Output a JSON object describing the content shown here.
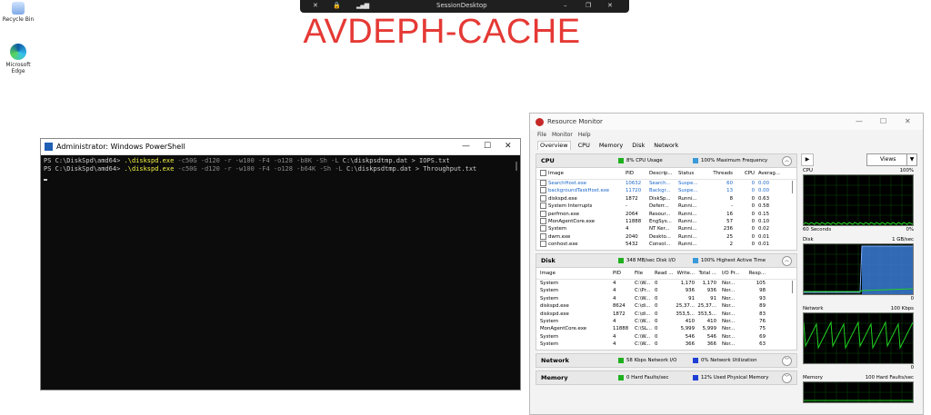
{
  "desktop": {
    "icons": [
      {
        "label": "Recycle Bin",
        "icon": "recycle-bin-icon"
      },
      {
        "label": "Microsoft Edge",
        "icon": "edge-icon"
      }
    ]
  },
  "session_bar": {
    "title": "SessionDesktop",
    "min": "–",
    "restore": "❐",
    "close": "✕"
  },
  "banner": {
    "text": "AVDEPH-CACHE",
    "color": "#e53935"
  },
  "powershell": {
    "title": "Administrator: Windows PowerShell",
    "lines": [
      {
        "prompt": "PS C:\\DiskSpd\\amd64> ",
        "cmd": ".\\diskspd.exe",
        "args": " -c50G -d120 -r -w100 -F4 -o128 -b8K -Sh -L ",
        "tail": "C:\\diskpsdtmp.dat > IOPS.txt"
      },
      {
        "prompt": "PS C:\\DiskSpd\\amd64> ",
        "cmd": ".\\diskspd.exe",
        "args": " -c50G -d120 -r -w100 -F4 -o128 -b64K -Sh -L ",
        "tail": "C:\\diskpsdtmp.dat > Throughput.txt"
      }
    ]
  },
  "resmon": {
    "title": "Resource Monitor",
    "menu": [
      "File",
      "Monitor",
      "Help"
    ],
    "tabs": [
      "Overview",
      "CPU",
      "Memory",
      "Disk",
      "Network"
    ],
    "cpu": {
      "name": "CPU",
      "usage": "8% CPU Usage",
      "freq": "100% Maximum Frequency",
      "headers": [
        "Image",
        "PID",
        "Descrip...",
        "Status",
        "Threads",
        "CPU",
        "Averag..."
      ],
      "rows": [
        [
          "SearchHost.exe",
          "10632",
          "Search...",
          "Suspe...",
          "60",
          "0",
          "0.00"
        ],
        [
          "backgroundTaskHost.exe",
          "11720",
          "Backgr...",
          "Suspe...",
          "13",
          "0",
          "0.00"
        ],
        [
          "diskspd.exe",
          "1872",
          "DiskSp...",
          "Runni...",
          "8",
          "0",
          "0.63"
        ],
        [
          "System Interrupts",
          "-",
          "Deferr...",
          "Runni...",
          "-",
          "0",
          "0.58"
        ],
        [
          "perfmon.exe",
          "2064",
          "Resour...",
          "Runni...",
          "16",
          "0",
          "0.15"
        ],
        [
          "MonAgentCore.exe",
          "11888",
          "EngSys...",
          "Runni...",
          "57",
          "0",
          "0.10"
        ],
        [
          "System",
          "4",
          "NT Ker...",
          "Runni...",
          "236",
          "0",
          "0.02"
        ],
        [
          "dwm.exe",
          "2040",
          "Deskto...",
          "Runni...",
          "25",
          "0",
          "0.01"
        ],
        [
          "conhost.exe",
          "5432",
          "Consol...",
          "Runni...",
          "2",
          "0",
          "0.01"
        ]
      ]
    },
    "disk": {
      "name": "Disk",
      "io": "348 MB/sec Disk I/O",
      "active": "100% Highest Active Time",
      "headers": [
        "Image",
        "PID",
        "File",
        "Read ...",
        "Write...",
        "Total ...",
        "I/O Pr...",
        "Resp..."
      ],
      "rows": [
        [
          "System",
          "4",
          "C:\\W...",
          "0",
          "1,170",
          "1,170",
          "Nor...",
          "105"
        ],
        [
          "System",
          "4",
          "C:\\Pr...",
          "0",
          "936",
          "936",
          "Nor...",
          "98"
        ],
        [
          "System",
          "4",
          "C:\\W...",
          "0",
          "91",
          "91",
          "Nor...",
          "93"
        ],
        [
          "diskspd.exe",
          "8624",
          "C:\\di...",
          "0",
          "25,37...",
          "25,37...",
          "Nor...",
          "89"
        ],
        [
          "diskspd.exe",
          "1872",
          "C:\\di...",
          "0",
          "353,5...",
          "353,5...",
          "Nor...",
          "83"
        ],
        [
          "System",
          "4",
          "C:\\W...",
          "0",
          "410",
          "410",
          "Nor...",
          "76"
        ],
        [
          "MonAgentCore.exe",
          "11888",
          "C:\\SL...",
          "0",
          "5,999",
          "5,999",
          "Nor...",
          "75"
        ],
        [
          "System",
          "4",
          "C:\\W...",
          "0",
          "546",
          "546",
          "Nor...",
          "69"
        ],
        [
          "System",
          "4",
          "C:\\W...",
          "0",
          "366",
          "366",
          "Nor...",
          "63"
        ]
      ]
    },
    "network": {
      "name": "Network",
      "io": "58 Kbps Network I/O",
      "util": "0% Network Utilization"
    },
    "memory": {
      "name": "Memory",
      "faults": "0 Hard Faults/sec",
      "used": "12% Used Physical Memory"
    },
    "side": {
      "views_label": "Views",
      "graphs": [
        {
          "name": "CPU",
          "max": "100%",
          "foot_left": "60 Seconds",
          "foot_right": "0%"
        },
        {
          "name": "Disk",
          "max": "1 GB/sec",
          "foot_left": "",
          "foot_right": "0"
        },
        {
          "name": "Network",
          "max": "100 Kbps",
          "foot_left": "",
          "foot_right": "0"
        },
        {
          "name": "Memory",
          "max": "100 Hard Faults/sec",
          "foot_left": "",
          "foot_right": ""
        }
      ]
    },
    "colors": {
      "green": "#1fb01f",
      "blue": "#1f5fd6",
      "graph_green": "#20d020",
      "graph_blue": "#3a7bd5"
    }
  }
}
